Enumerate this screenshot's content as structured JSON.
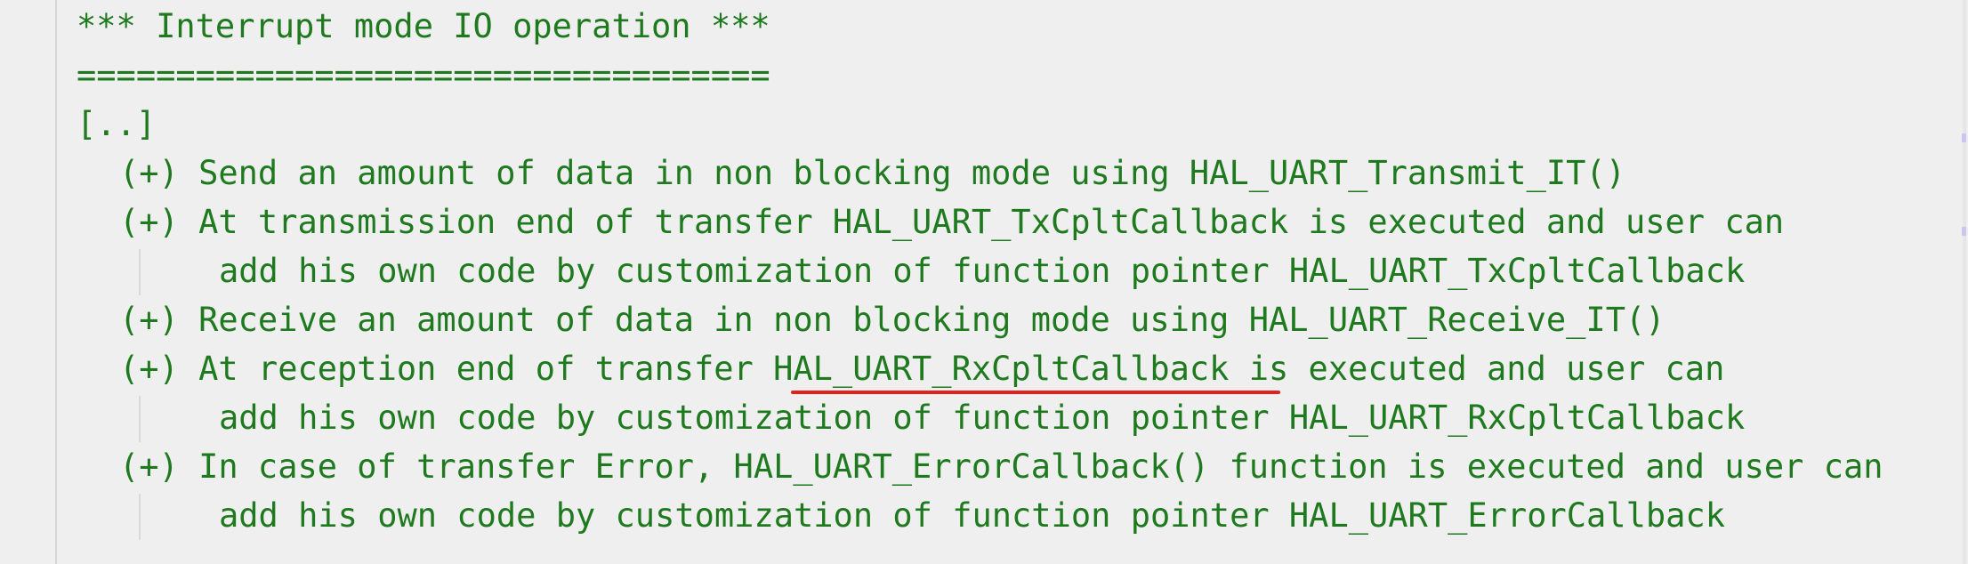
{
  "editor": {
    "lines": {
      "heading": "*** Interrupt mode IO operation ***",
      "rule": "===================================",
      "ellipsis": "[..]",
      "item_transmit": "(+) Send an amount of data in non blocking mode using HAL_UART_Transmit_IT()",
      "item_tx_callback": "(+) At transmission end of transfer HAL_UART_TxCpltCallback is executed and user can",
      "item_tx_callback_cont": "add his own code by customization of function pointer HAL_UART_TxCpltCallback",
      "item_receive": "(+) Receive an amount of data in non blocking mode using HAL_UART_Receive_IT()",
      "item_rx_callback": "(+) At reception end of transfer HAL_UART_RxCpltCallback is executed and user can",
      "item_rx_callback_cont": "add his own code by customization of function pointer HAL_UART_RxCpltCallback",
      "item_error": "(+) In case of transfer Error, HAL_UART_ErrorCallback() function is executed and user can",
      "item_error_cont": "add his own code by customization of function pointer HAL_UART_ErrorCallback"
    },
    "highlight": {
      "token": "HAL_UART_RxCpltCallback",
      "color": "#e0211d"
    },
    "text_color": "#1f7a1f",
    "background_color": "#efefef"
  }
}
